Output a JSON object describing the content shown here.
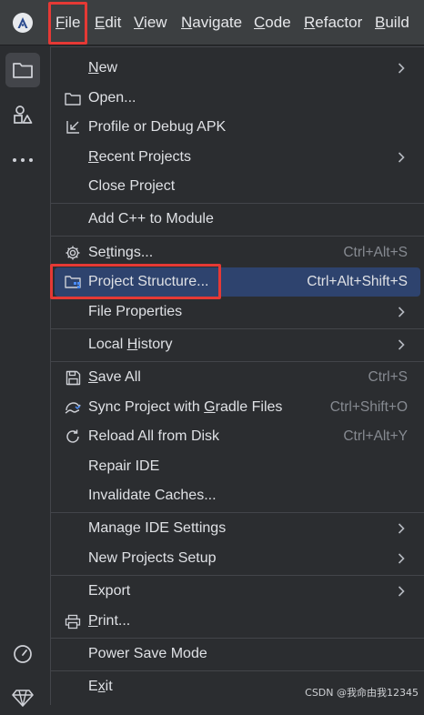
{
  "menubar": {
    "items": [
      {
        "label": "File",
        "mnemonic": "F",
        "rest": "ile"
      },
      {
        "label": "Edit",
        "mnemonic": "E",
        "rest": "dit"
      },
      {
        "label": "View",
        "mnemonic": "V",
        "rest": "iew"
      },
      {
        "label": "Navigate",
        "mnemonic": "N",
        "rest": "avigate"
      },
      {
        "label": "Code",
        "mnemonic": "C",
        "rest": "ode"
      },
      {
        "label": "Refactor",
        "mnemonic": "R",
        "rest": "efactor"
      },
      {
        "label": "Build",
        "mnemonic": "B",
        "rest": "uild"
      }
    ]
  },
  "file_menu": {
    "new": {
      "pre": "",
      "u": "N",
      "post": "ew"
    },
    "open": {
      "pre": "Open...",
      "u": "",
      "post": ""
    },
    "profile": {
      "pre": "Profile or Debug APK",
      "u": "",
      "post": ""
    },
    "recent": {
      "pre": "",
      "u": "R",
      "post": "ecent Projects"
    },
    "close": {
      "pre": "Close Project",
      "u": "",
      "post": ""
    },
    "add_cpp": {
      "pre": "Add C++ to Module",
      "u": "",
      "post": ""
    },
    "settings": {
      "pre": "Se",
      "u": "t",
      "post": "tings...",
      "shortcut": "Ctrl+Alt+S"
    },
    "project_structure": {
      "pre": "Project Structure...",
      "u": "",
      "post": "",
      "shortcut": "Ctrl+Alt+Shift+S"
    },
    "file_properties": {
      "pre": "File Properties",
      "u": "",
      "post": ""
    },
    "local_history": {
      "pre": "Local ",
      "u": "H",
      "post": "istory"
    },
    "save_all": {
      "pre": "",
      "u": "S",
      "post": "ave All",
      "shortcut": "Ctrl+S"
    },
    "sync": {
      "pre": "Sync Project with ",
      "u": "G",
      "post": "radle Files",
      "shortcut": "Ctrl+Shift+O"
    },
    "reload": {
      "pre": "Reload All from Disk",
      "u": "",
      "post": "",
      "shortcut": "Ctrl+Alt+Y"
    },
    "repair": {
      "pre": "Repair IDE",
      "u": "",
      "post": ""
    },
    "invalidate": {
      "pre": "Invalidate Caches...",
      "u": "",
      "post": ""
    },
    "manage": {
      "pre": "Manage IDE Settings",
      "u": "",
      "post": ""
    },
    "new_setup": {
      "pre": "New Projects Setup",
      "u": "",
      "post": ""
    },
    "export": {
      "pre": "Export",
      "u": "",
      "post": ""
    },
    "print": {
      "pre": "",
      "u": "P",
      "post": "rint..."
    },
    "power": {
      "pre": "Power Save Mode",
      "u": "",
      "post": ""
    },
    "exit": {
      "pre": "E",
      "u": "x",
      "post": "it"
    }
  },
  "watermark": "CSDN @我命由我12345",
  "colors": {
    "menubar_bg": "#3c3f41",
    "menu_bg": "#2b2d30",
    "selected_bg": "#2e436e",
    "highlight_box": "#e53935",
    "shortcut_text": "#868a91"
  }
}
